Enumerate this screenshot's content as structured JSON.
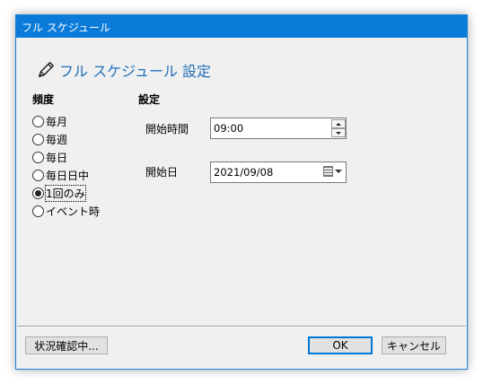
{
  "window": {
    "title": "フル スケジュール"
  },
  "heading": {
    "text": "フル スケジュール 設定",
    "icon": "pencil-icon",
    "color": "#1f6fb8"
  },
  "frequency": {
    "label": "頻度",
    "options": [
      {
        "label": "毎月",
        "checked": false
      },
      {
        "label": "毎週",
        "checked": false
      },
      {
        "label": "毎日",
        "checked": false
      },
      {
        "label": "毎日日中",
        "checked": false
      },
      {
        "label": "1回のみ",
        "checked": true
      },
      {
        "label": "イベント時",
        "checked": false
      }
    ]
  },
  "settings": {
    "label": "設定",
    "start_time_label": "開始時間",
    "start_time_value": "09:00",
    "start_date_label": "開始日",
    "start_date_value": "2021/09/08"
  },
  "footer": {
    "status_button": "状況確認中...",
    "ok_button": "OK",
    "cancel_button": "キャンセル"
  },
  "colors": {
    "titlebar": "#0a7bd8",
    "accent": "#0078d7"
  }
}
